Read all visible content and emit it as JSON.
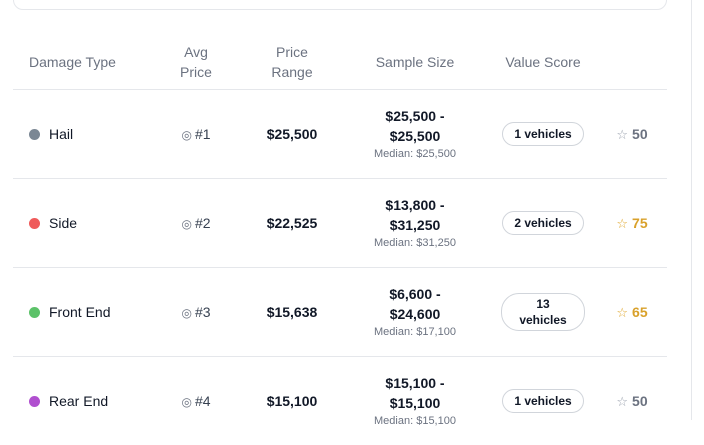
{
  "table": {
    "headers": {
      "damage_type": "Damage Type",
      "avg_price": "Avg Price",
      "price_range": "Price Range",
      "sample_size": "Sample Size",
      "value_score": "Value Score"
    },
    "rows": [
      {
        "type": "Hail",
        "dot_color": "#7b8794",
        "rank": "#1",
        "price": "$25,500",
        "range": "$25,500 - $25,500",
        "median": "Median: $25,500",
        "sample": "1 vehicles",
        "score": "50",
        "score_color": "#6b7280",
        "star_color": "#9ca3af"
      },
      {
        "type": "Side",
        "dot_color": "#ef5a5a",
        "rank": "#2",
        "price": "$22,525",
        "range": "$13,800 - $31,250",
        "median": "Median: $31,250",
        "sample": "2 vehicles",
        "score": "75",
        "score_color": "#d9a12b",
        "star_color": "#e0a82e"
      },
      {
        "type": "Front End",
        "dot_color": "#5cc269",
        "rank": "#3",
        "price": "$15,638",
        "range": "$6,600 - $24,600",
        "median": "Median: $17,100",
        "sample": "13 vehicles",
        "score": "65",
        "score_color": "#d9a12b",
        "star_color": "#e0a82e"
      },
      {
        "type": "Rear End",
        "dot_color": "#b04fcf",
        "rank": "#4",
        "price": "$15,100",
        "range": "$15,100 - $15,100",
        "median": "Median: $15,100",
        "sample": "1 vehicles",
        "score": "50",
        "score_color": "#6b7280",
        "star_color": "#9ca3af"
      }
    ]
  },
  "icons": {
    "rank": "target-icon",
    "score": "star-outline-icon"
  }
}
